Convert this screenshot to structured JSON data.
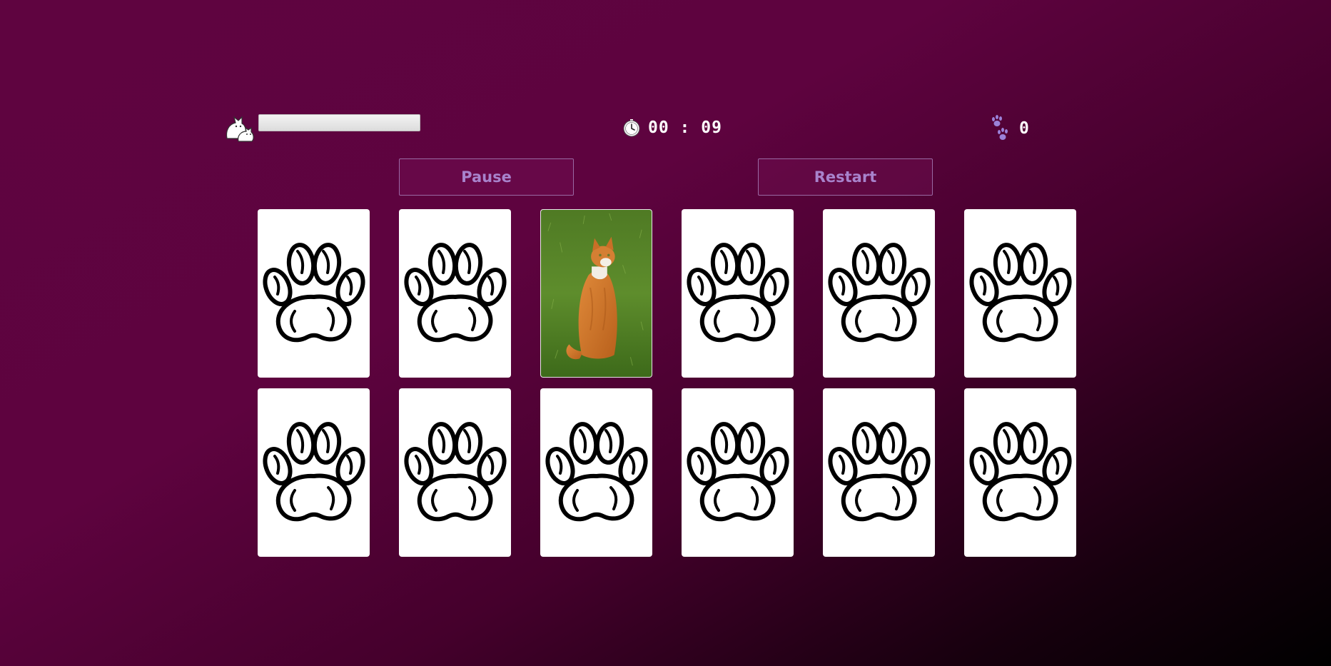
{
  "header": {
    "player_icon": "cat-and-kitten-icon",
    "player_name_value": "",
    "timer_icon": "stopwatch-icon",
    "timer_text": "00 : 09",
    "moves_icon": "paw-prints-icon",
    "moves_count": "0"
  },
  "controls": {
    "pause_label": "Pause",
    "restart_label": "Restart"
  },
  "board": {
    "card_back_icon": "paw-print-icon",
    "cards": [
      {
        "state": "face-down"
      },
      {
        "state": "face-down"
      },
      {
        "state": "face-up",
        "image": "orange-cat-on-grass"
      },
      {
        "state": "face-down"
      },
      {
        "state": "face-down"
      },
      {
        "state": "face-down"
      },
      {
        "state": "face-down"
      },
      {
        "state": "face-down"
      },
      {
        "state": "face-down"
      },
      {
        "state": "face-down"
      },
      {
        "state": "face-down"
      },
      {
        "state": "face-down"
      }
    ]
  },
  "colors": {
    "background_start": "#5f0440",
    "background_end": "#000000",
    "button_text": "#a883cc",
    "button_border": "#9a6aa4",
    "card_face": "#ffffff"
  }
}
